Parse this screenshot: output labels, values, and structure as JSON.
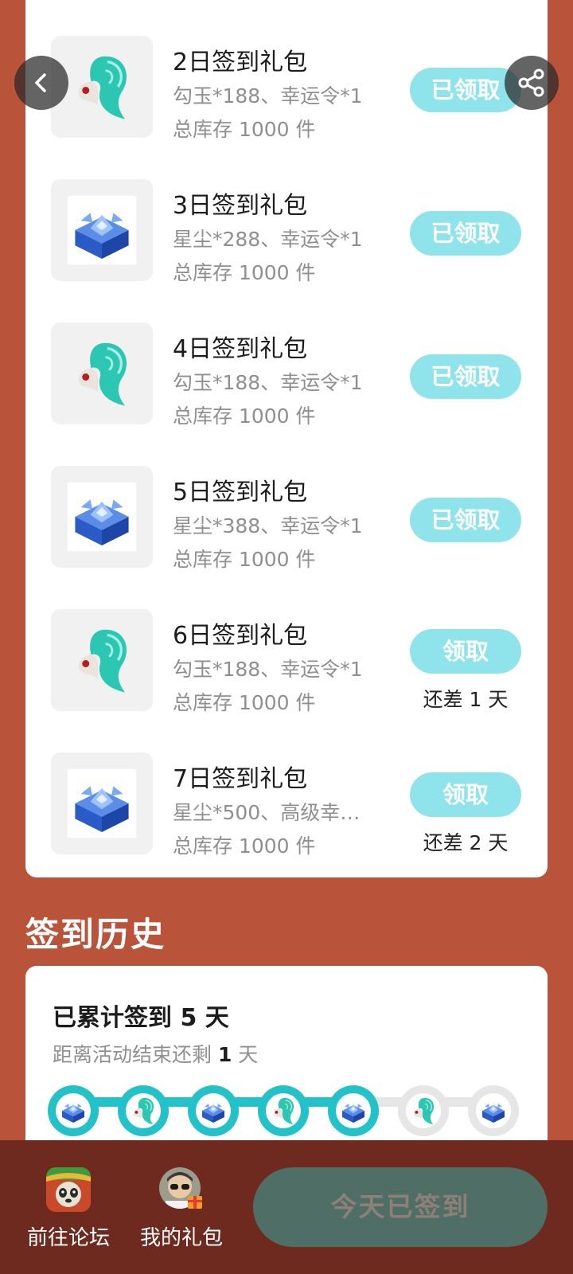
{
  "nav": {
    "back_icon": "chevron-left-icon",
    "share_icon": "share-icon"
  },
  "gifts": [
    {
      "title": "2日签到礼包",
      "desc": "勾玉*188、幸运令*1",
      "stock": "总库存 1000 件",
      "button": "已领取",
      "remain": "",
      "item": "jade"
    },
    {
      "title": "3日签到礼包",
      "desc": "星尘*288、幸运令*1",
      "stock": "总库存 1000 件",
      "button": "已领取",
      "remain": "",
      "item": "chest"
    },
    {
      "title": "4日签到礼包",
      "desc": "勾玉*188、幸运令*1",
      "stock": "总库存 1000 件",
      "button": "已领取",
      "remain": "",
      "item": "jade"
    },
    {
      "title": "5日签到礼包",
      "desc": "星尘*388、幸运令*1",
      "stock": "总库存 1000 件",
      "button": "已领取",
      "remain": "",
      "item": "chest"
    },
    {
      "title": "6日签到礼包",
      "desc": "勾玉*188、幸运令*1",
      "stock": "总库存 1000 件",
      "button": "领取",
      "remain": "还差 1 天",
      "item": "jade"
    },
    {
      "title": "7日签到礼包",
      "desc": "星尘*500、高级幸…",
      "stock": "总库存 1000 件",
      "button": "领取",
      "remain": "还差 2 天",
      "item": "chest"
    }
  ],
  "history": {
    "title": "签到历史",
    "summary_prefix": "已累计签到 ",
    "summary_days": "5",
    "summary_suffix": " 天",
    "remaining_prefix": "距离活动结束还剩 ",
    "remaining_days": "1",
    "remaining_suffix": " 天",
    "days_signed": 5,
    "total_days": 7
  },
  "bottom": {
    "forum_label": "前往论坛",
    "gifts_label": "我的礼包",
    "signed_label": "今天已签到"
  },
  "colors": {
    "background": "#B9533A",
    "button_claimed": "#8FE3EA",
    "progress_active": "#23C2C9",
    "bottom_bar": "#6E2A1F",
    "signed_button": "#4F6E66"
  }
}
